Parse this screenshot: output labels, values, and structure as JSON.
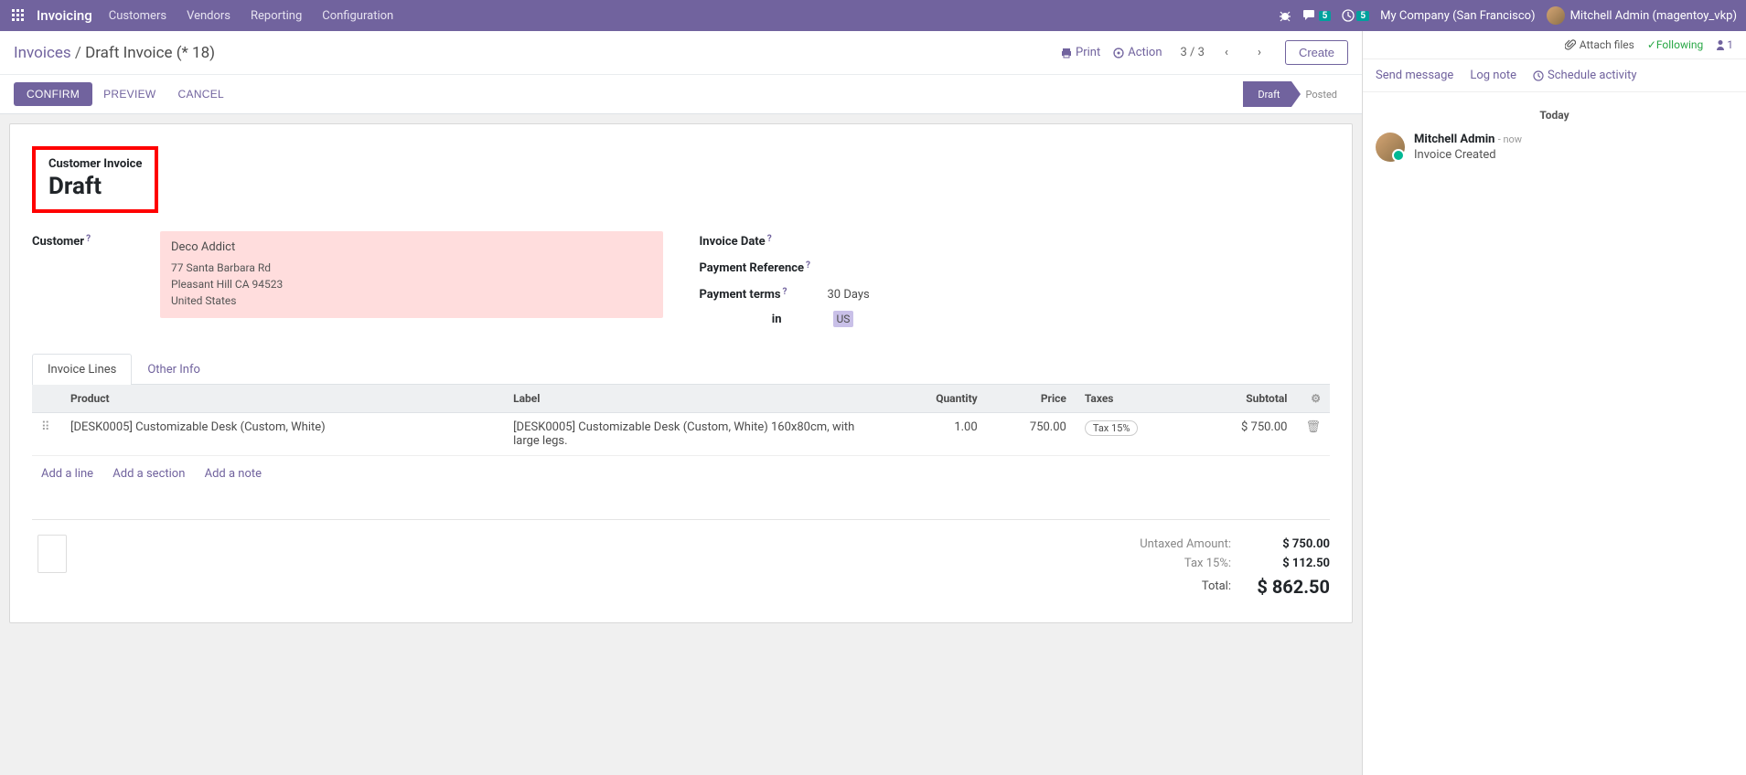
{
  "topbar": {
    "brand": "Invoicing",
    "menu": [
      "Customers",
      "Vendors",
      "Reporting",
      "Configuration"
    ],
    "conversations_badge": "5",
    "mail_badge": "5",
    "company": "My Company (San Francisco)",
    "user": "Mitchell Admin (magentoy_vkp)"
  },
  "breadcrumb": {
    "parent": "Invoices",
    "current": "Draft Invoice (* 18)",
    "print": "Print",
    "action": "Action",
    "pager": "3 / 3",
    "create": "Create"
  },
  "statusbar": {
    "confirm": "Confirm",
    "preview": "Preview",
    "cancel": "Cancel",
    "draft": "Draft",
    "posted": "Posted"
  },
  "invoice": {
    "subtitle": "Customer Invoice",
    "title": "Draft",
    "customer_label": "Customer",
    "customer_name": "Deco Addict",
    "addr_line1": "77 Santa Barbara Rd",
    "addr_line2": "Pleasant Hill CA 94523",
    "addr_country": "United States",
    "date_label": "Invoice Date",
    "ref_label": "Payment Reference",
    "terms_label": "Payment terms",
    "terms_value": "30 Days",
    "currency_in": "in",
    "currency": "US"
  },
  "tabs": {
    "lines": "Invoice Lines",
    "other": "Other Info"
  },
  "table": {
    "headers": {
      "product": "Product",
      "label": "Label",
      "qty": "Quantity",
      "price": "Price",
      "taxes": "Taxes",
      "subtotal": "Subtotal"
    },
    "rows": [
      {
        "product": "[DESK0005] Customizable Desk (Custom, White)",
        "label": "[DESK0005] Customizable Desk (Custom, White) 160x80cm, with large legs.",
        "qty": "1.00",
        "price": "750.00",
        "tax": "Tax 15%",
        "subtotal": "$ 750.00"
      }
    ],
    "add_line": "Add a line",
    "add_section": "Add a section",
    "add_note": "Add a note"
  },
  "totals": {
    "untaxed_label": "Untaxed Amount:",
    "untaxed_value": "$ 750.00",
    "tax_label": "Tax 15%:",
    "tax_value": "$ 112.50",
    "total_label": "Total:",
    "total_value": "$ 862.50"
  },
  "chatter": {
    "attach": "Attach files",
    "following": "Following",
    "follower_count": "1",
    "send": "Send message",
    "log": "Log note",
    "schedule": "Schedule activity",
    "date": "Today",
    "msg_author": "Mitchell Admin",
    "msg_time": "- now",
    "msg_text": "Invoice Created"
  }
}
